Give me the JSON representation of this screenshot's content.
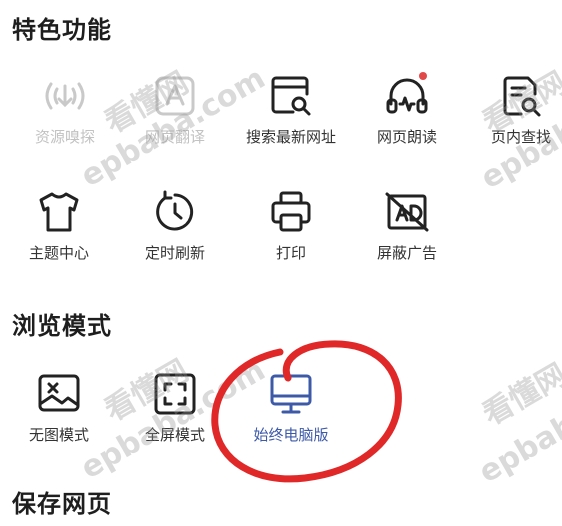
{
  "sections": {
    "features_title": "特色功能",
    "browse_title": "浏览模式",
    "save_title": "保存网页"
  },
  "features": [
    {
      "label": "资源嗅探",
      "icon": "sniff-icon",
      "enabled": false
    },
    {
      "label": "网页翻译",
      "icon": "translate-icon",
      "enabled": false
    },
    {
      "label": "搜索最新网址",
      "icon": "search-url-icon",
      "enabled": true
    },
    {
      "label": "网页朗读",
      "icon": "headphones-icon",
      "enabled": true,
      "badge": true
    },
    {
      "label": "页内查找",
      "icon": "find-in-page-icon",
      "enabled": true
    },
    {
      "label": "主题中心",
      "icon": "tshirt-icon",
      "enabled": true
    },
    {
      "label": "定时刷新",
      "icon": "timer-refresh-icon",
      "enabled": true
    },
    {
      "label": "打印",
      "icon": "printer-icon",
      "enabled": true
    },
    {
      "label": "屏蔽广告",
      "icon": "ad-block-icon",
      "enabled": true
    }
  ],
  "browse_modes": [
    {
      "label": "无图模式",
      "icon": "no-image-icon"
    },
    {
      "label": "全屏模式",
      "icon": "fullscreen-icon"
    },
    {
      "label": "始终电脑版",
      "icon": "desktop-icon",
      "active": true
    }
  ],
  "watermarks": [
    "看懂网",
    "epbaba.com"
  ],
  "colors": {
    "accent": "#3d5aa8",
    "badge": "#e34848",
    "disabled": "#c2c2c2",
    "annotation": "#e02828"
  }
}
